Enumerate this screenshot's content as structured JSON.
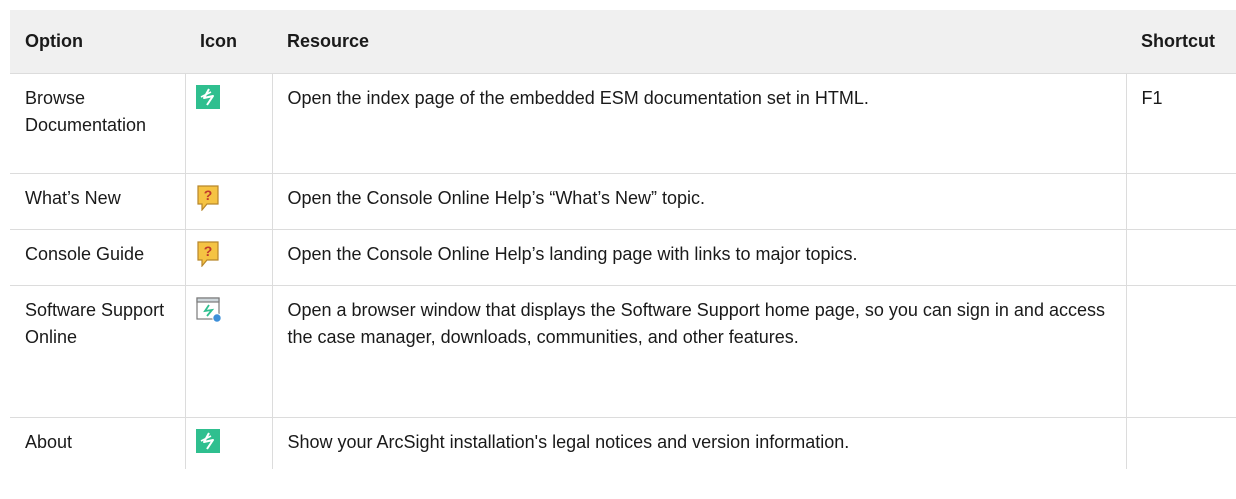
{
  "table": {
    "headers": {
      "option": "Option",
      "icon": "Icon",
      "resource": "Resource",
      "shortcut": "Shortcut"
    },
    "rows": [
      {
        "option": "Browse Documentation",
        "icon": "arcsight-icon",
        "resource": "Open the index page of the embedded ESM documentation set in HTML.",
        "shortcut": "F1"
      },
      {
        "option": "What’s New",
        "icon": "help-question-icon",
        "resource": "Open the Console Online Help’s “What’s New” topic.",
        "shortcut": ""
      },
      {
        "option": "Console Guide",
        "icon": "help-question-icon",
        "resource": "Open the Console Online Help’s landing page with links to major topics.",
        "shortcut": ""
      },
      {
        "option": "Software Support Online",
        "icon": "support-window-icon",
        "resource": "Open a browser window that displays the Software Support home page, so you can sign in and access the case manager, downloads, communities, and other features.",
        "shortcut": ""
      },
      {
        "option": "About",
        "icon": "arcsight-icon",
        "resource": "Show your ArcSight installation's legal notices and version information.",
        "shortcut": ""
      }
    ]
  },
  "colors": {
    "header_bg": "#f0f0f0",
    "border": "#dcdcdc",
    "arcsight_green": "#2fbf8f",
    "help_yellow": "#f5c343"
  }
}
